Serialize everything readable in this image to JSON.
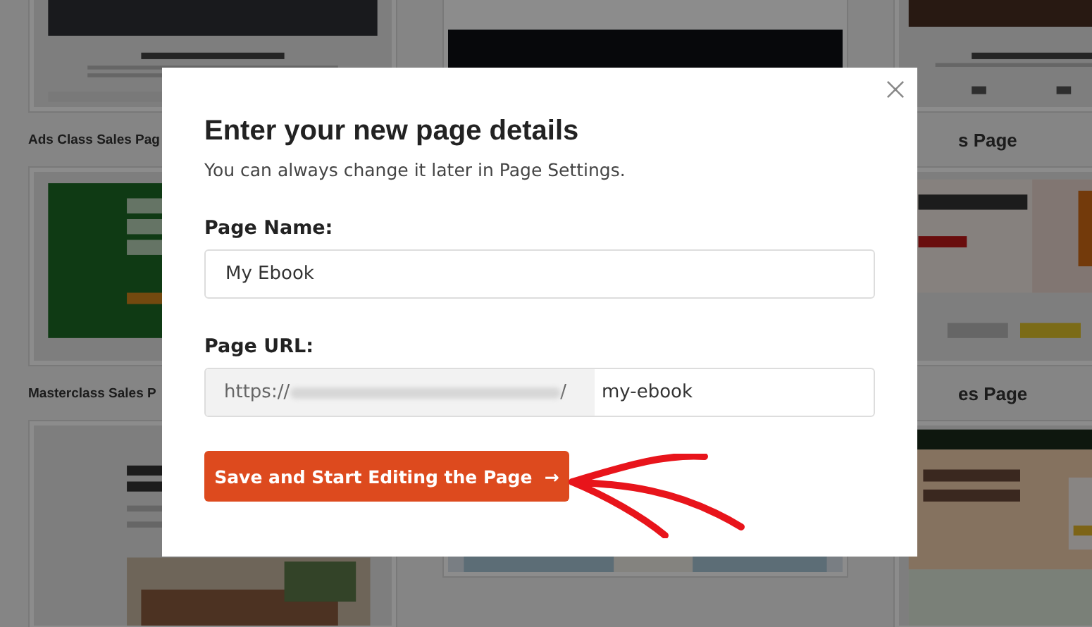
{
  "gallery": {
    "columns": [
      {
        "cards": [
          {
            "thumbnail": {
              "kind": "picture"
            },
            "label": "Ads Class Sales Pag"
          },
          {
            "thumbnail": {
              "kind": "picture"
            },
            "label": "Masterclass Sales P"
          },
          {
            "thumbnail": {
              "kind": "picture"
            }
          }
        ]
      },
      {
        "cards": [
          {
            "thumbnail": {
              "kind": "picture"
            }
          },
          {
            "thumbnail": {
              "kind": "picture"
            }
          }
        ]
      },
      {
        "cards": [
          {
            "thumbnail": {
              "kind": "picture"
            },
            "label": "s Page"
          },
          {
            "thumbnail": {
              "kind": "picture"
            },
            "label": "es Page"
          },
          {
            "thumbnail": {
              "kind": "picture"
            }
          }
        ]
      }
    ]
  },
  "dialog": {
    "title": "Enter your new page details",
    "subtitle": "You can always change it later in Page Settings.",
    "page_name": {
      "label": "Page Name:",
      "value": "My Ebook"
    },
    "page_url": {
      "label": "Page URL:",
      "prefix": "https://",
      "prefix_end": "/",
      "value": "my-ebook"
    },
    "submit": {
      "label": "Save and Start Editing the Page",
      "arrow": "→"
    }
  }
}
